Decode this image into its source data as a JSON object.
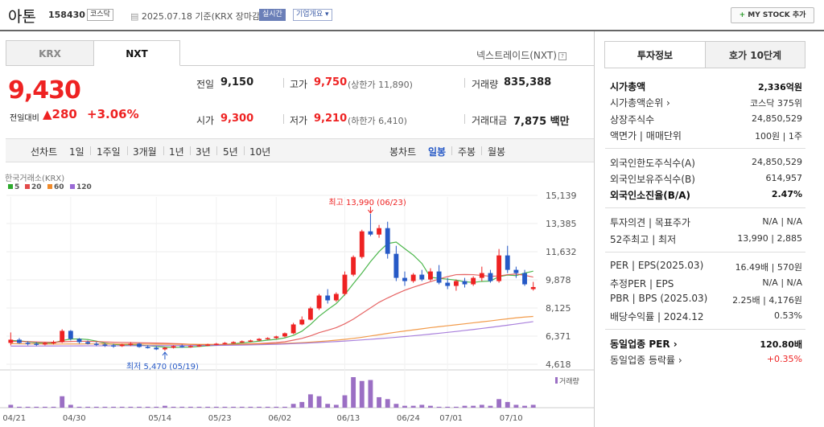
{
  "header": {
    "name": "아톤",
    "code": "158430",
    "market": "코스닥",
    "date_text": "2025.07.18  기준(KRX 장마감)",
    "realtime": "실시간",
    "overview": "기업개요 ▾",
    "mystock": "MY STOCK 추가",
    "mystock_plus": "+"
  },
  "tabs": {
    "krx": "KRX",
    "nxt": "NXT",
    "nxt_label": "넥스트레이드(NXT)"
  },
  "price": {
    "current": "9,430",
    "change_label": "전일대비",
    "change": "▲280",
    "change_pct": "+3.06%"
  },
  "quote": {
    "prev_label": "전일",
    "prev": "9,150",
    "high_label": "고가",
    "high": "9,750",
    "high_limit": "(상한가 11,890)",
    "volume_label": "거래량",
    "volume": "835,388",
    "open_label": "시가",
    "open": "9,300",
    "low_label": "저가",
    "low": "9,210",
    "low_limit": "(하한가 6,410)",
    "amount_label": "거래대금",
    "amount": "7,875 백만"
  },
  "toolbar": {
    "line_chart": "선차트",
    "d1": "1일",
    "w1": "1주일",
    "m3": "3개월",
    "y1": "1년",
    "y3": "3년",
    "y5": "5년",
    "y10": "10년",
    "candle": "봉차트",
    "daily": "일봉",
    "weekly": "주봉",
    "monthly": "월봉"
  },
  "chart_data": {
    "type": "candlestick",
    "source_label": "한국거래소(KRX)",
    "legend": [
      {
        "name": "5",
        "color": "#2eaa2e"
      },
      {
        "name": "20",
        "color": "#e24a4a"
      },
      {
        "name": "60",
        "color": "#f08a2a"
      },
      {
        "name": "120",
        "color": "#9a6ad6"
      }
    ],
    "y_ticks": [
      "15,139",
      "13,385",
      "11,632",
      "9,878",
      "8,125",
      "6,371",
      "4,618"
    ],
    "ylim": [
      4618,
      15139
    ],
    "x_ticks": [
      "04/21",
      "04/30",
      "05/14",
      "05/23",
      "06/02",
      "06/13",
      "06/24",
      "07/01",
      "07/10"
    ],
    "high_annotation": "최고 13,990 (06/23)",
    "low_annotation": "최저 5,470 (05/19)",
    "volume_label": "거래량",
    "candles": [
      [
        5950,
        6600,
        5800,
        6150
      ],
      [
        6150,
        6250,
        5900,
        5950
      ],
      [
        5950,
        6050,
        5800,
        5900
      ],
      [
        5900,
        6000,
        5750,
        5850
      ],
      [
        5850,
        6000,
        5800,
        5950
      ],
      [
        5950,
        6100,
        5850,
        6000
      ],
      [
        6000,
        6800,
        5950,
        6700
      ],
      [
        6700,
        6750,
        6100,
        6200
      ],
      [
        6200,
        6250,
        5900,
        6000
      ],
      [
        6000,
        6100,
        5850,
        5900
      ],
      [
        5900,
        6000,
        5750,
        5850
      ],
      [
        5850,
        5950,
        5700,
        5800
      ],
      [
        5800,
        5900,
        5650,
        5750
      ],
      [
        5750,
        5900,
        5700,
        5850
      ],
      [
        5850,
        6000,
        5750,
        5900
      ],
      [
        5900,
        5950,
        5650,
        5700
      ],
      [
        5700,
        5800,
        5600,
        5650
      ],
      [
        5650,
        5750,
        5500,
        5550
      ],
      [
        5550,
        5700,
        5470,
        5650
      ],
      [
        5650,
        5800,
        5600,
        5750
      ],
      [
        5750,
        5850,
        5650,
        5700
      ],
      [
        5700,
        5800,
        5650,
        5750
      ],
      [
        5750,
        5850,
        5700,
        5800
      ],
      [
        5800,
        5900,
        5750,
        5850
      ],
      [
        5850,
        5950,
        5800,
        5900
      ],
      [
        5900,
        6000,
        5850,
        5950
      ],
      [
        5950,
        6050,
        5900,
        6000
      ],
      [
        6000,
        6100,
        5950,
        6050
      ],
      [
        6050,
        6150,
        6000,
        6100
      ],
      [
        6100,
        6250,
        6050,
        6200
      ],
      [
        6200,
        6300,
        6150,
        6250
      ],
      [
        6250,
        6400,
        6200,
        6350
      ],
      [
        6350,
        6600,
        6300,
        6550
      ],
      [
        6550,
        7200,
        6500,
        7100
      ],
      [
        7100,
        7600,
        7050,
        7400
      ],
      [
        7400,
        8200,
        7350,
        8100
      ],
      [
        8100,
        9000,
        8000,
        8900
      ],
      [
        8900,
        9300,
        8400,
        8600
      ],
      [
        8600,
        9100,
        8500,
        9000
      ],
      [
        9000,
        10400,
        8900,
        10200
      ],
      [
        10200,
        11400,
        10100,
        11300
      ],
      [
        11300,
        13000,
        11200,
        12900
      ],
      [
        12900,
        13990,
        12600,
        12700
      ],
      [
        12700,
        13300,
        12500,
        13100
      ],
      [
        13100,
        13500,
        11200,
        11500
      ],
      [
        11500,
        12000,
        9800,
        10000
      ],
      [
        10000,
        10400,
        9500,
        9800
      ],
      [
        9800,
        10300,
        9700,
        10200
      ],
      [
        10200,
        10500,
        9800,
        9900
      ],
      [
        9900,
        10600,
        9800,
        10400
      ],
      [
        10400,
        10800,
        9600,
        9700
      ],
      [
        9700,
        10000,
        9300,
        9500
      ],
      [
        9500,
        9900,
        9200,
        9800
      ],
      [
        9800,
        10000,
        9400,
        9600
      ],
      [
        9600,
        10100,
        9500,
        10000
      ],
      [
        10000,
        10700,
        9800,
        10300
      ],
      [
        10300,
        10500,
        9700,
        9800
      ],
      [
        9800,
        11800,
        9700,
        11400
      ],
      [
        11400,
        12000,
        10300,
        10500
      ],
      [
        10500,
        10700,
        10000,
        10300
      ],
      [
        10300,
        10500,
        9500,
        9600
      ],
      [
        9300,
        9750,
        9210,
        9430
      ]
    ],
    "ma5": [
      6100,
      6080,
      6020,
      5950,
      5930,
      5940,
      6100,
      6190,
      6200,
      6160,
      6060,
      5930,
      5860,
      5820,
      5830,
      5810,
      5780,
      5730,
      5690,
      5670,
      5680,
      5690,
      5730,
      5770,
      5800,
      5850,
      5900,
      5950,
      6000,
      6060,
      6120,
      6170,
      6260,
      6420,
      6680,
      7100,
      7610,
      8020,
      8400,
      8960,
      9640,
      10300,
      11010,
      11640,
      12140,
      12230,
      11820,
      11420,
      10900,
      10040,
      9970,
      9920,
      9860,
      9760,
      9720,
      9780,
      9800,
      10080,
      10180,
      10140,
      10300,
      10420
    ],
    "ma20": [
      6050,
      6040,
      6030,
      6010,
      6000,
      5990,
      6020,
      6040,
      6050,
      6050,
      6030,
      6010,
      5990,
      5980,
      5970,
      5960,
      5950,
      5940,
      5930,
      5910,
      5890,
      5860,
      5840,
      5830,
      5830,
      5840,
      5850,
      5870,
      5890,
      5910,
      5940,
      5970,
      6020,
      6120,
      6230,
      6390,
      6590,
      6740,
      6900,
      7140,
      7430,
      7780,
      8130,
      8480,
      8750,
      9000,
      9230,
      9420,
      9590,
      9760,
      9930,
      10080,
      10200,
      10210,
      10200,
      10150,
      10100,
      10120,
      10200,
      10240,
      10160,
      10050
    ],
    "ma60": [
      5900,
      5895,
      5890,
      5885,
      5880,
      5878,
      5880,
      5882,
      5884,
      5886,
      5886,
      5884,
      5882,
      5880,
      5878,
      5876,
      5874,
      5872,
      5870,
      5868,
      5866,
      5864,
      5862,
      5860,
      5860,
      5862,
      5866,
      5870,
      5876,
      5884,
      5894,
      5906,
      5920,
      5940,
      5966,
      5996,
      6032,
      6074,
      6120,
      6170,
      6230,
      6300,
      6380,
      6460,
      6540,
      6620,
      6690,
      6760,
      6830,
      6900,
      6960,
      7020,
      7080,
      7140,
      7200,
      7260,
      7320,
      7390,
      7450,
      7510,
      7560,
      7600
    ],
    "ma120": [
      5750,
      5750,
      5752,
      5754,
      5756,
      5758,
      5760,
      5762,
      5764,
      5766,
      5768,
      5770,
      5772,
      5774,
      5776,
      5778,
      5780,
      5782,
      5784,
      5786,
      5788,
      5790,
      5792,
      5794,
      5796,
      5800,
      5806,
      5814,
      5824,
      5836,
      5850,
      5866,
      5884,
      5904,
      5926,
      5950,
      5976,
      6004,
      6034,
      6066,
      6100,
      6136,
      6174,
      6214,
      6256,
      6300,
      6346,
      6394,
      6444,
      6496,
      6550,
      6606,
      6664,
      6724,
      6786,
      6850,
      6916,
      6984,
      7054,
      7126,
      7200,
      7276
    ],
    "volumes": [
      3,
      1,
      1,
      1,
      1,
      1,
      12,
      3,
      1,
      1,
      1,
      1,
      1,
      1,
      1,
      1,
      1,
      1,
      2,
      1,
      1,
      1,
      1,
      1,
      1,
      1,
      1,
      1,
      1,
      1,
      1,
      1,
      1,
      4,
      6,
      14,
      12,
      4,
      3,
      13,
      32,
      28,
      29,
      11,
      9,
      4,
      2,
      2,
      3,
      2,
      1,
      1,
      1,
      2,
      2,
      3,
      2,
      9,
      6,
      3,
      2,
      3
    ]
  },
  "info_panel": {
    "tab_info": "투자정보",
    "tab_hoga": "호가 10단계",
    "rows": [
      {
        "k": "시가총액",
        "v": "2,336억원",
        "bold": true
      },
      {
        "k": "시가총액순위 ›",
        "v": "코스닥 375위"
      },
      {
        "k": "상장주식수",
        "v": "24,850,529"
      },
      {
        "k": "액면가 | 매매단위",
        "v": "100원 | 1주"
      },
      {
        "k": "외국인한도주식수(A)",
        "v": "24,850,529"
      },
      {
        "k": "외국인보유주식수(B)",
        "v": "614,957"
      },
      {
        "k": "외국인소진율(B/A)",
        "v": "2.47%",
        "bold": true
      },
      {
        "k": "투자의견 | 목표주가",
        "v": "N/A | N/A"
      },
      {
        "k": "52주최고 | 최저",
        "v": "13,990 | 2,885"
      },
      {
        "k": "PER | EPS(2025.03)",
        "v": "16.49배 | 570원"
      },
      {
        "k": "추정PER | EPS",
        "v": "N/A | N/A"
      },
      {
        "k": "PBR | BPS (2025.03)",
        "v": "2.25배 | 4,176원"
      },
      {
        "k": "배당수익률 | 2024.12",
        "v": "0.53%"
      },
      {
        "k": "동일업종 PER ›",
        "v": "120.80배",
        "bold": true
      },
      {
        "k": "동일업종 등락률 ›",
        "v": "+0.35%",
        "red": true
      }
    ]
  }
}
